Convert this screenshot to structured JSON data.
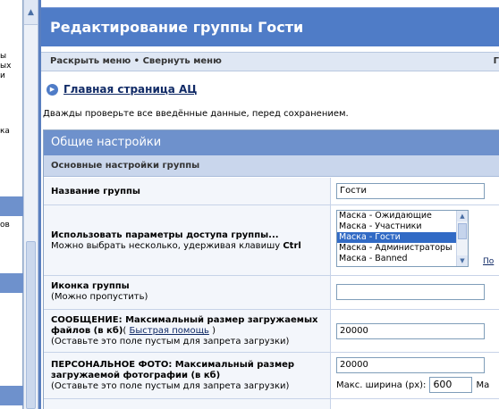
{
  "sidebar": {
    "fragments": [
      "ы",
      "ых",
      "и",
      "ка",
      "ов"
    ]
  },
  "header": {
    "title": "Редактирование группы Гости"
  },
  "menu": {
    "expand": "Раскрыть меню",
    "separator": "•",
    "collapse": "Свернуть меню",
    "right_fragment": "Г"
  },
  "home_link": "Главная страница АЦ",
  "note": "Дважды проверьте все введённые данные, перед сохранением.",
  "section": {
    "title": "Общие настройки",
    "subtitle": "Основные настройки группы"
  },
  "rows": {
    "group_name": {
      "label": "Название группы",
      "value": "Гости"
    },
    "access": {
      "label": "Использовать параметры доступа группы...",
      "hint": "Можно выбрать несколько, удерживая клавишу",
      "key": "Ctrl",
      "options": [
        "Маска - Ожидающие",
        "Маска - Участники",
        "Маска - Гости",
        "Маска - Администраторы",
        "Маска - Banned"
      ],
      "selected": "Маска - Гости",
      "side_link": "По"
    },
    "icon": {
      "label": "Иконка группы",
      "hint": "(Можно пропустить)",
      "value": ""
    },
    "message": {
      "label": "СООБЩЕНИЕ: Максимальный размер загружаемых файлов (в кб)",
      "help_prefix": "(",
      "help_link": "Быстрая помощь",
      "help_suffix": ")",
      "hint": "(Оставьте это поле пустым для запрета загрузки)",
      "value": "20000"
    },
    "photo": {
      "label": "ПЕРСОНАЛЬНОЕ ФОТО: Максимальный размер загружаемой фотографии (в кб)",
      "hint": "(Оставьте это поле пустым для запрета загрузки)",
      "value": "20000",
      "max_width_label": "Макс. ширина (px):",
      "max_width": "600",
      "max_tail": "Ма"
    }
  },
  "colors": {
    "title_bg": "#4f7cc7",
    "section_bg": "#6e91cc",
    "subheader_bg": "#c9d6ec",
    "selected_bg": "#316ac5"
  }
}
